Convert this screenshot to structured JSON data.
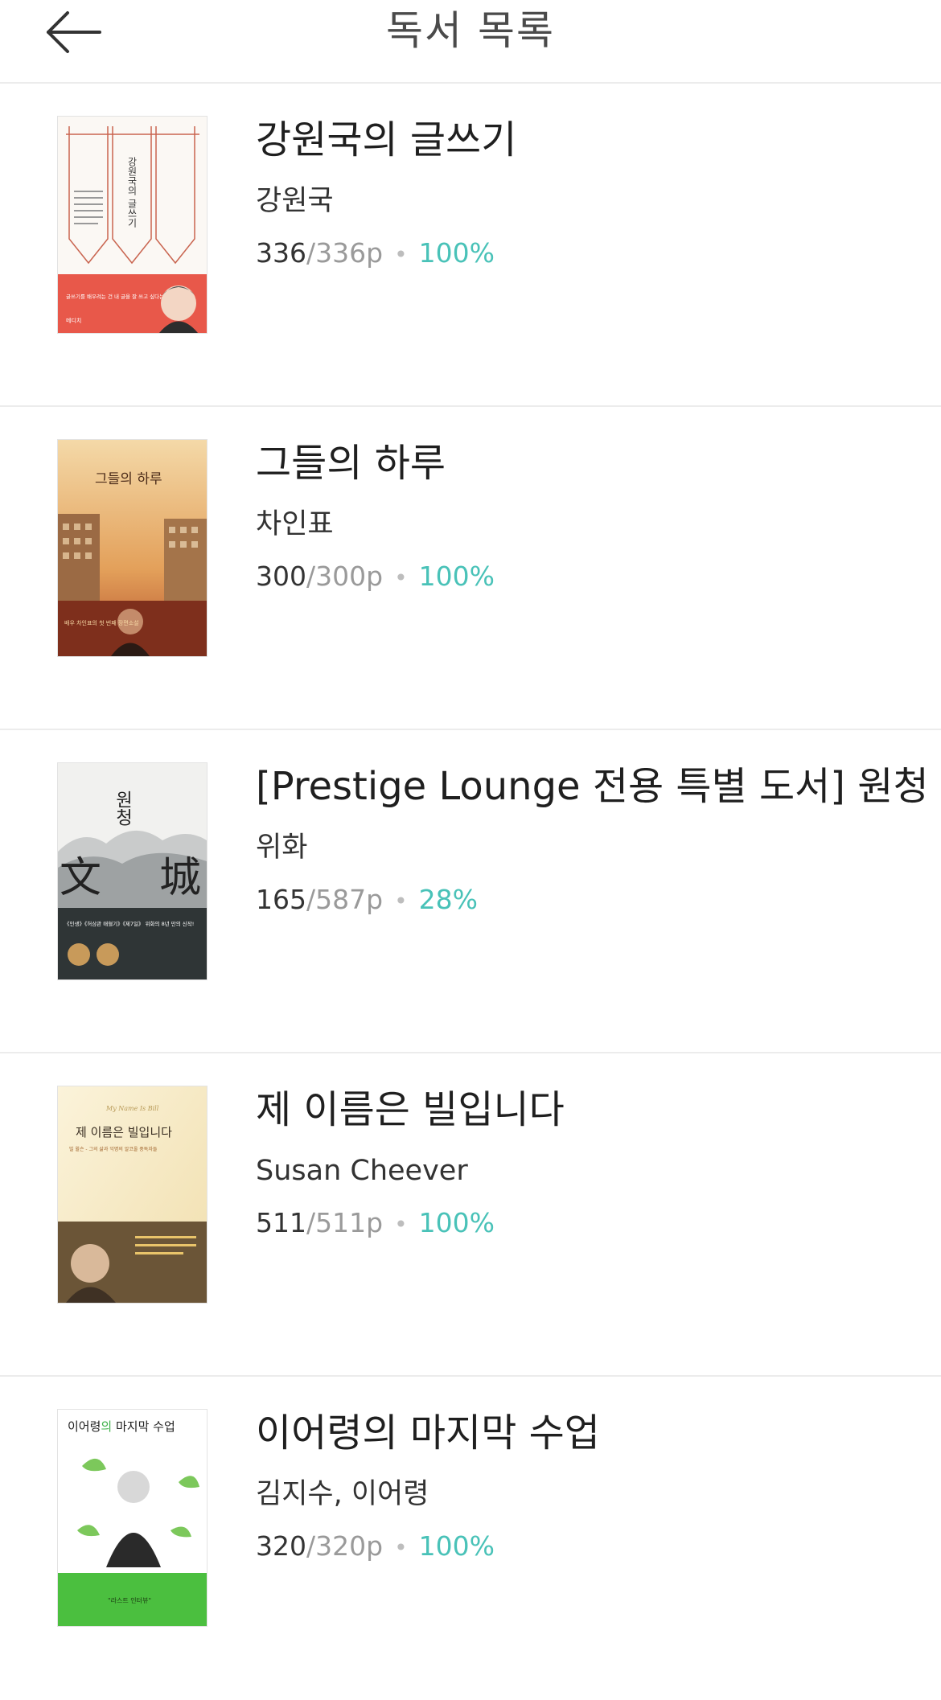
{
  "header": {
    "title": "독서 목록",
    "back_icon": "arrow-left-icon"
  },
  "colors": {
    "accent": "#49c2b8",
    "muted": "#9a9a9a",
    "divider": "#ececec"
  },
  "books": [
    {
      "title": "강원국의 글쓰기",
      "author": "강원국",
      "pages_read": "336",
      "pages_total": "/336p",
      "separator": "•",
      "percent": "100%",
      "cover": {
        "title": "강원국의 글쓰기",
        "tagline": "글쓰기를 배우려는 건 내 글을 잘 쓰고 싶다는 것",
        "publisher": "메디치"
      }
    },
    {
      "title": "그들의 하루",
      "author": "차인표",
      "pages_read": "300",
      "pages_total": "/300p",
      "separator": "•",
      "percent": "100%",
      "cover": {
        "title": "그들의 하루",
        "tagline": "배우 차인표의 첫 번째 장편소설"
      }
    },
    {
      "title": "[Prestige Lounge 전용 특별 도서] 원청",
      "author": "위화",
      "pages_read": "165",
      "pages_total": "/587p",
      "separator": "•",
      "percent": "28%",
      "cover": {
        "title": "원청",
        "big_left": "文",
        "big_right": "城",
        "tagline": "《인생》《허삼관 매혈기》《제7일》 위화의 8년 만의 신작!"
      }
    },
    {
      "title": "제 이름은 빌입니다",
      "author": "Susan Cheever",
      "pages_read": "511",
      "pages_total": "/511p",
      "separator": "•",
      "percent": "100%",
      "cover": {
        "title": "제 이름은 빌입니다",
        "script": "My Name Is Bill",
        "tagline": "빌 윌슨 - 그의 삶과 익명의 알코올 중독자들"
      }
    },
    {
      "title": "이어령의 마지막 수업",
      "author": "김지수, 이어령",
      "pages_read": "320",
      "pages_total": "/320p",
      "separator": "•",
      "percent": "100%",
      "cover": {
        "title_a": "이어령",
        "title_b": "의",
        "title_c": " 마지막 수업",
        "tagline": "\"라스트 인터뷰\""
      }
    }
  ]
}
